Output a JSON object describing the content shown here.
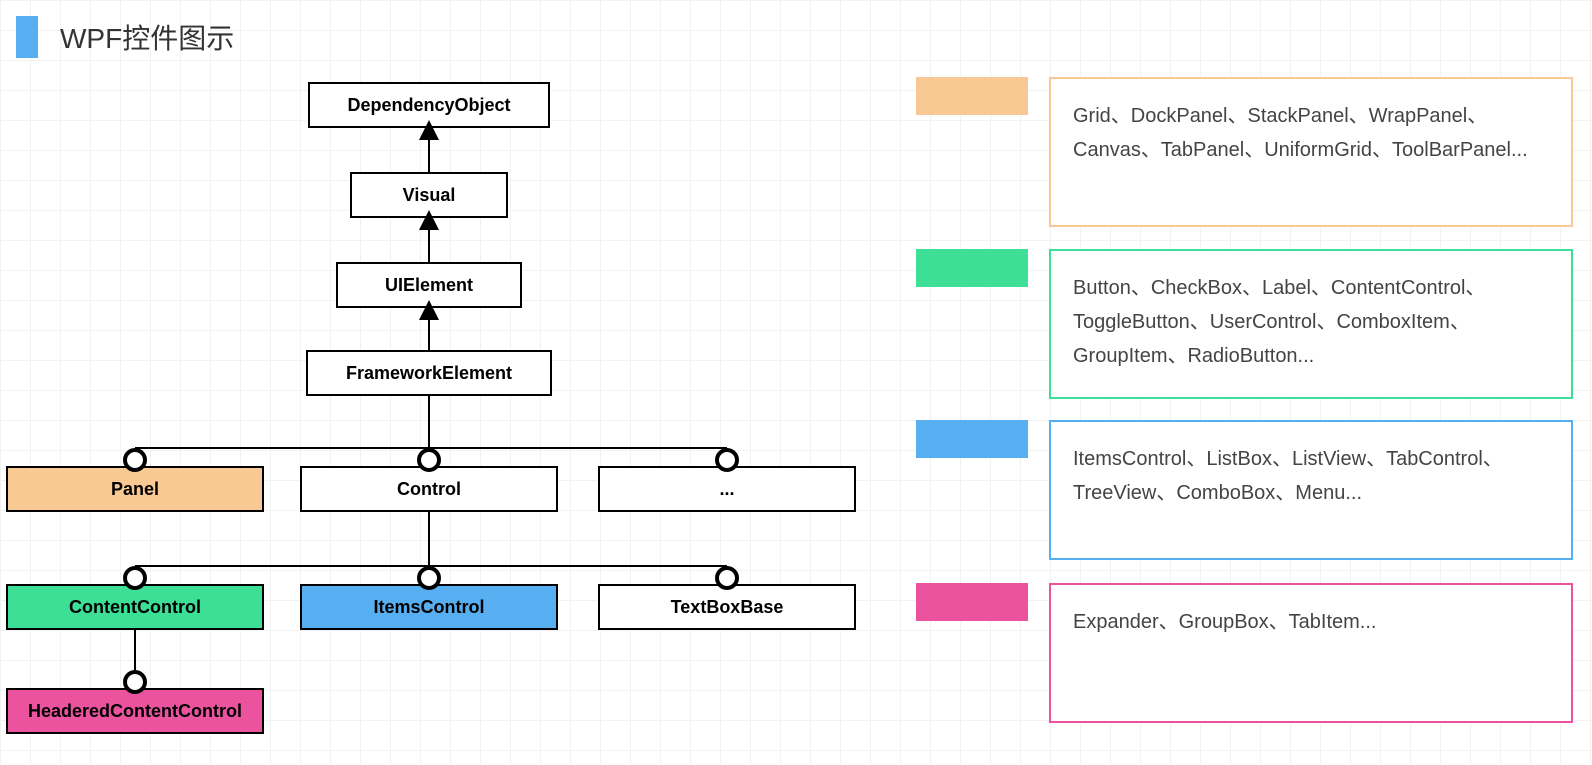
{
  "title": "WPF控件图示",
  "nodes": {
    "dependencyObject": "DependencyObject",
    "visual": "Visual",
    "uiElement": "UIElement",
    "frameworkElement": "FrameworkElement",
    "panel": "Panel",
    "control": "Control",
    "ellipsis": "...",
    "contentControl": "ContentControl",
    "itemsControl": "ItemsControl",
    "textBoxBase": "TextBoxBase",
    "headeredContentControl": "HeaderedContentControl"
  },
  "legend": {
    "orange": "Grid、DockPanel、StackPanel、WrapPanel、Canvas、TabPanel、UniformGrid、ToolBarPanel...",
    "green": "Button、CheckBox、Label、ContentControl、ToggleButton、UserControl、ComboxItem、GroupItem、RadioButton...",
    "blue": "ItemsControl、ListBox、ListView、TabControl、TreeView、ComboBox、Menu...",
    "pink": "Expander、GroupBox、TabItem..."
  },
  "colors": {
    "orange": "#f9c994",
    "green": "#3dde95",
    "blue": "#57aef0",
    "pink": "#ec539f"
  }
}
